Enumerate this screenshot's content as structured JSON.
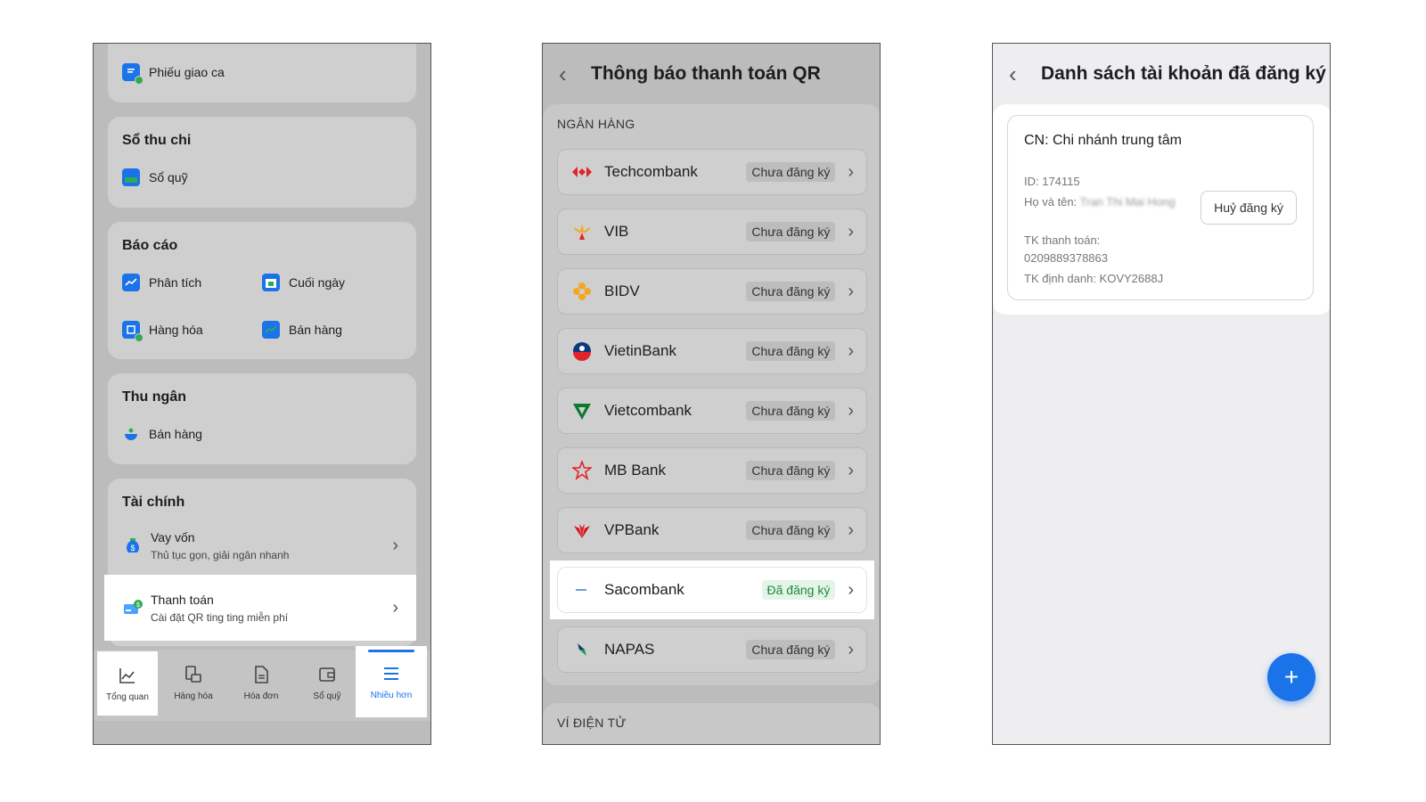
{
  "screen1": {
    "shift_item": "Phiếu giao ca",
    "cashbook": {
      "title": "Sổ thu chi",
      "item": "Sổ quỹ"
    },
    "reports": {
      "title": "Báo cáo",
      "items": [
        "Phân tích",
        "Cuối ngày",
        "Hàng hóa",
        "Bán hàng"
      ]
    },
    "cashier": {
      "title": "Thu ngân",
      "item": "Bán hàng"
    },
    "finance": {
      "title": "Tài chính",
      "loan_title": "Vay vốn",
      "loan_sub": "Thủ tục gọn, giải ngân nhanh",
      "payment_title": "Thanh toán",
      "payment_sub": "Cài đặt QR ting ting miễn phí"
    },
    "tabs": [
      "Tổng quan",
      "Hàng hóa",
      "Hóa đơn",
      "Sổ quỹ",
      "Nhiều hơn"
    ],
    "active_tab": "Nhiều hơn"
  },
  "screen2": {
    "title": "Thông báo thanh toán QR",
    "bank_section": "NGÂN HÀNG",
    "wallet_section": "VÍ ĐIỆN TỬ",
    "banks": [
      {
        "name": "Techcombank",
        "status": "Chưa đăng ký"
      },
      {
        "name": "VIB",
        "status": "Chưa đăng ký"
      },
      {
        "name": "BIDV",
        "status": "Chưa đăng ký"
      },
      {
        "name": "VietinBank",
        "status": "Chưa đăng ký"
      },
      {
        "name": "Vietcombank",
        "status": "Chưa đăng ký"
      },
      {
        "name": "MB Bank",
        "status": "Chưa đăng ký"
      },
      {
        "name": "VPBank",
        "status": "Chưa đăng ký"
      },
      {
        "name": "Sacombank",
        "status": "Đã đăng ký"
      },
      {
        "name": "NAPAS",
        "status": "Chưa đăng ký"
      }
    ]
  },
  "screen3": {
    "title": "Danh sách tài khoản đã đăng ký",
    "account": {
      "branch": "CN: Chi nhánh trung tâm",
      "id": "ID: 174115",
      "name_label": "Họ và tên:",
      "name_value": "Tran Thi Mai Hong",
      "acct_label": "TK thanh toán:",
      "acct_value": "0209889378863",
      "alias": "TK định danh: KOVY2688J"
    },
    "unregister_button": "Huỷ đăng ký",
    "fab_label": "+"
  },
  "colors": {
    "accent": "#1a73e8",
    "registered_green": "#1c8a3b",
    "dim_overlay": "#bcbcbc"
  },
  "icons": {
    "back": "chevron-left-icon",
    "row_arrow": "chevron-right-icon",
    "add": "plus-icon"
  }
}
